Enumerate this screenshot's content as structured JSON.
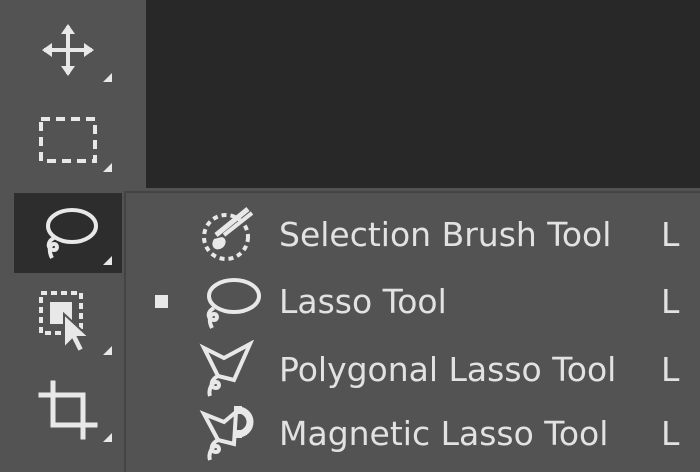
{
  "toolbar": {
    "tools": [
      {
        "name": "move-tool",
        "icon": "move-icon"
      },
      {
        "name": "rectangular-marquee-tool",
        "icon": "marquee-icon"
      },
      {
        "name": "lasso-tool",
        "icon": "lasso-icon",
        "active": true
      },
      {
        "name": "object-selection-tool",
        "icon": "object-selection-icon"
      },
      {
        "name": "crop-tool",
        "icon": "crop-icon"
      }
    ]
  },
  "flyout": {
    "items": [
      {
        "label": "Selection Brush Tool",
        "shortcut": "L",
        "icon": "selection-brush-icon",
        "selected": false
      },
      {
        "label": "Lasso Tool",
        "shortcut": "L",
        "icon": "lasso-icon",
        "selected": true
      },
      {
        "label": "Polygonal Lasso Tool",
        "shortcut": "L",
        "icon": "polygonal-lasso-icon",
        "selected": false
      },
      {
        "label": "Magnetic Lasso Tool",
        "shortcut": "L",
        "icon": "magnetic-lasso-icon",
        "selected": false
      }
    ]
  },
  "colors": {
    "panel": "#535353",
    "canvas": "#282828",
    "active_tool": "#2d2d2d",
    "text": "#e2e2e2"
  }
}
